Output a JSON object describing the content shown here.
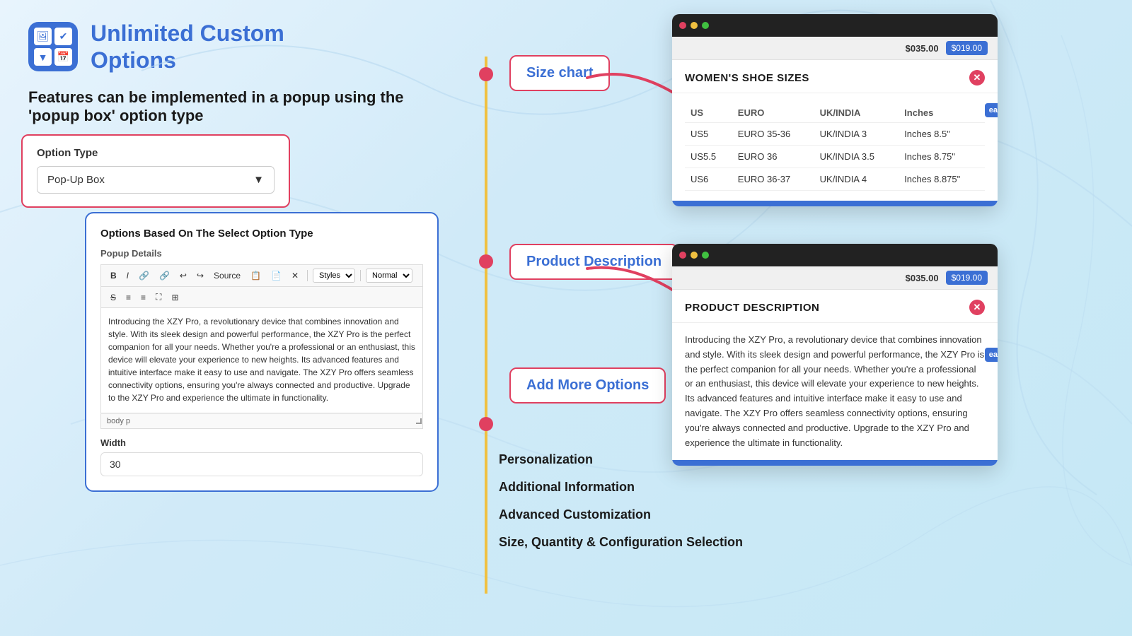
{
  "app": {
    "title_line1": "Unlimited Custom",
    "title_line2": "Options"
  },
  "subtitle": "Features can be implemented in a popup using the 'popup box' option type",
  "option_type": {
    "label": "Option Type",
    "value": "Pop-Up Box"
  },
  "inner_card": {
    "title": "Options Based On The Select Option Type",
    "popup_details_label": "Popup Details",
    "editor_content": "Introducing the XZY Pro, a revolutionary device that combines innovation and style. With its sleek design and powerful performance, the XZY Pro is the perfect companion for all your needs. Whether you're a professional or an enthusiast, this device will elevate your experience to new heights. Its advanced features and intuitive interface make it easy to use and navigate. The XZY Pro offers seamless connectivity options, ensuring you're always connected and productive. Upgrade to the XZY Pro and experience the ultimate in functionality.",
    "editor_footer": "body  p",
    "width_label": "Width",
    "width_value": "30",
    "toolbar_styles": "Styles",
    "toolbar_format": "Normal"
  },
  "labels": {
    "size_chart": "Size chart",
    "product_description": "Product Description",
    "add_more_options": "Add More Options"
  },
  "size_chart_popup": {
    "title": "WOMEN'S SHOE SIZES",
    "headers": [
      "US",
      "EURO",
      "UK/INDIA",
      "Inches"
    ],
    "rows": [
      [
        "US5",
        "EURO 35-36",
        "UK/INDIA 3",
        "Inches 8.5\""
      ],
      [
        "US5.5",
        "EURO 36",
        "UK/INDIA 3.5",
        "Inches 8.75\""
      ],
      [
        "US6",
        "EURO 36-37",
        "UK/INDIA 4",
        "Inches 8.875\""
      ]
    ],
    "price_old": "$035.00",
    "price_new": "$019.00"
  },
  "product_desc_popup": {
    "title": "PRODUCT DESCRIPTION",
    "content": "Introducing the XZY Pro, a revolutionary device that combines innovation and style. With its sleek design and powerful performance, the XZY Pro is the perfect companion for all your needs. Whether you're a professional or an enthusiast, this device will elevate your experience to new heights. Its advanced features and intuitive interface make it easy to use and navigate. The XZY Pro offers seamless connectivity options, ensuring you're always connected and productive. Upgrade to the XZY Pro and experience the ultimate in functionality.",
    "price_old": "$035.00",
    "price_new": "$019.00"
  },
  "add_more_items": [
    "Personalization",
    "Additional Information",
    "Advanced Customization",
    "Size, Quantity & Configuration Selection"
  ],
  "icons": {
    "image_icon": "🖼",
    "check_icon": "✔",
    "dropdown_icon": "▼",
    "calendar_icon": "📅",
    "bold": "B",
    "italic": "I",
    "close": "✕"
  }
}
